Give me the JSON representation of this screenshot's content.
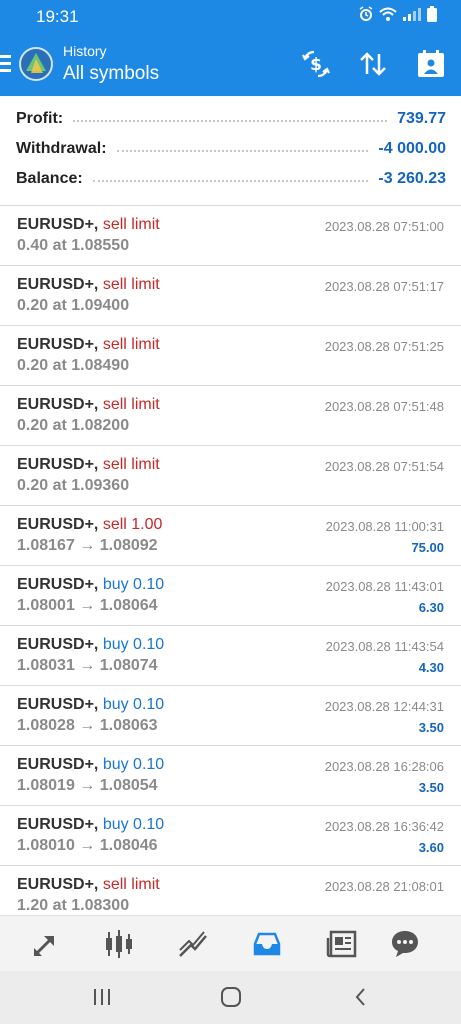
{
  "status_bar": {
    "time": "19:31",
    "icons": [
      "alarm-icon",
      "wifi-icon",
      "signal-icon",
      "battery-icon"
    ]
  },
  "app_bar": {
    "subtitle": "History",
    "title": "All symbols",
    "actions": [
      "dollar-swap-icon",
      "sort-icon",
      "calendar-icon"
    ],
    "background": "#1e88e5"
  },
  "summary": {
    "profit_label": "Profit:",
    "profit_value": "739.77",
    "withdrawal_label": "Withdrawal:",
    "withdrawal_value": "-4 000.00",
    "balance_label": "Balance:",
    "balance_value": "-3 260.23"
  },
  "orders": [
    {
      "symbol": "EURUSD+,",
      "type": "sell limit",
      "side": "sell",
      "detail": "0.40 at 1.08550",
      "time": "2023.08.28 07:51:00",
      "profit": ""
    },
    {
      "symbol": "EURUSD+,",
      "type": "sell limit",
      "side": "sell",
      "detail": "0.20 at 1.09400",
      "time": "2023.08.28 07:51:17",
      "profit": ""
    },
    {
      "symbol": "EURUSD+,",
      "type": "sell limit",
      "side": "sell",
      "detail": "0.20 at 1.08490",
      "time": "2023.08.28 07:51:25",
      "profit": ""
    },
    {
      "symbol": "EURUSD+,",
      "type": "sell limit",
      "side": "sell",
      "detail": "0.20 at 1.08200",
      "time": "2023.08.28 07:51:48",
      "profit": ""
    },
    {
      "symbol": "EURUSD+,",
      "type": "sell limit",
      "side": "sell",
      "detail": "0.20 at 1.09360",
      "time": "2023.08.28 07:51:54",
      "profit": ""
    },
    {
      "symbol": "EURUSD+,",
      "type": "sell 1.00",
      "side": "sell",
      "detail": "1.08167 → 1.08092",
      "time": "2023.08.28 11:00:31",
      "profit": "75.00"
    },
    {
      "symbol": "EURUSD+,",
      "type": "buy 0.10",
      "side": "buy",
      "detail": "1.08001 → 1.08064",
      "time": "2023.08.28 11:43:01",
      "profit": "6.30"
    },
    {
      "symbol": "EURUSD+,",
      "type": "buy 0.10",
      "side": "buy",
      "detail": "1.08031 → 1.08074",
      "time": "2023.08.28 11:43:54",
      "profit": "4.30"
    },
    {
      "symbol": "EURUSD+,",
      "type": "buy 0.10",
      "side": "buy",
      "detail": "1.08028 → 1.08063",
      "time": "2023.08.28 12:44:31",
      "profit": "3.50"
    },
    {
      "symbol": "EURUSD+,",
      "type": "buy 0.10",
      "side": "buy",
      "detail": "1.08019 → 1.08054",
      "time": "2023.08.28 16:28:06",
      "profit": "3.50"
    },
    {
      "symbol": "EURUSD+,",
      "type": "buy 0.10",
      "side": "buy",
      "detail": "1.08010 → 1.08046",
      "time": "2023.08.28 16:36:42",
      "profit": "3.60"
    },
    {
      "symbol": "EURUSD+,",
      "type": "sell limit",
      "side": "sell",
      "detail": "1.20 at 1.08300",
      "time": "2023.08.28 21:08:01",
      "profit": ""
    }
  ],
  "bottom_nav": {
    "items": [
      "quotes-icon",
      "chart-icon",
      "trade-icon",
      "history-icon",
      "news-icon",
      "chat-icon"
    ],
    "active": "history-icon"
  },
  "colors": {
    "accent": "#1e88e5",
    "sell": "#c62828",
    "buy": "#1976d2",
    "profit": "#1565c0",
    "muted": "#8a8a8a"
  },
  "system_nav": [
    "recents-icon",
    "home-icon",
    "back-icon"
  ]
}
